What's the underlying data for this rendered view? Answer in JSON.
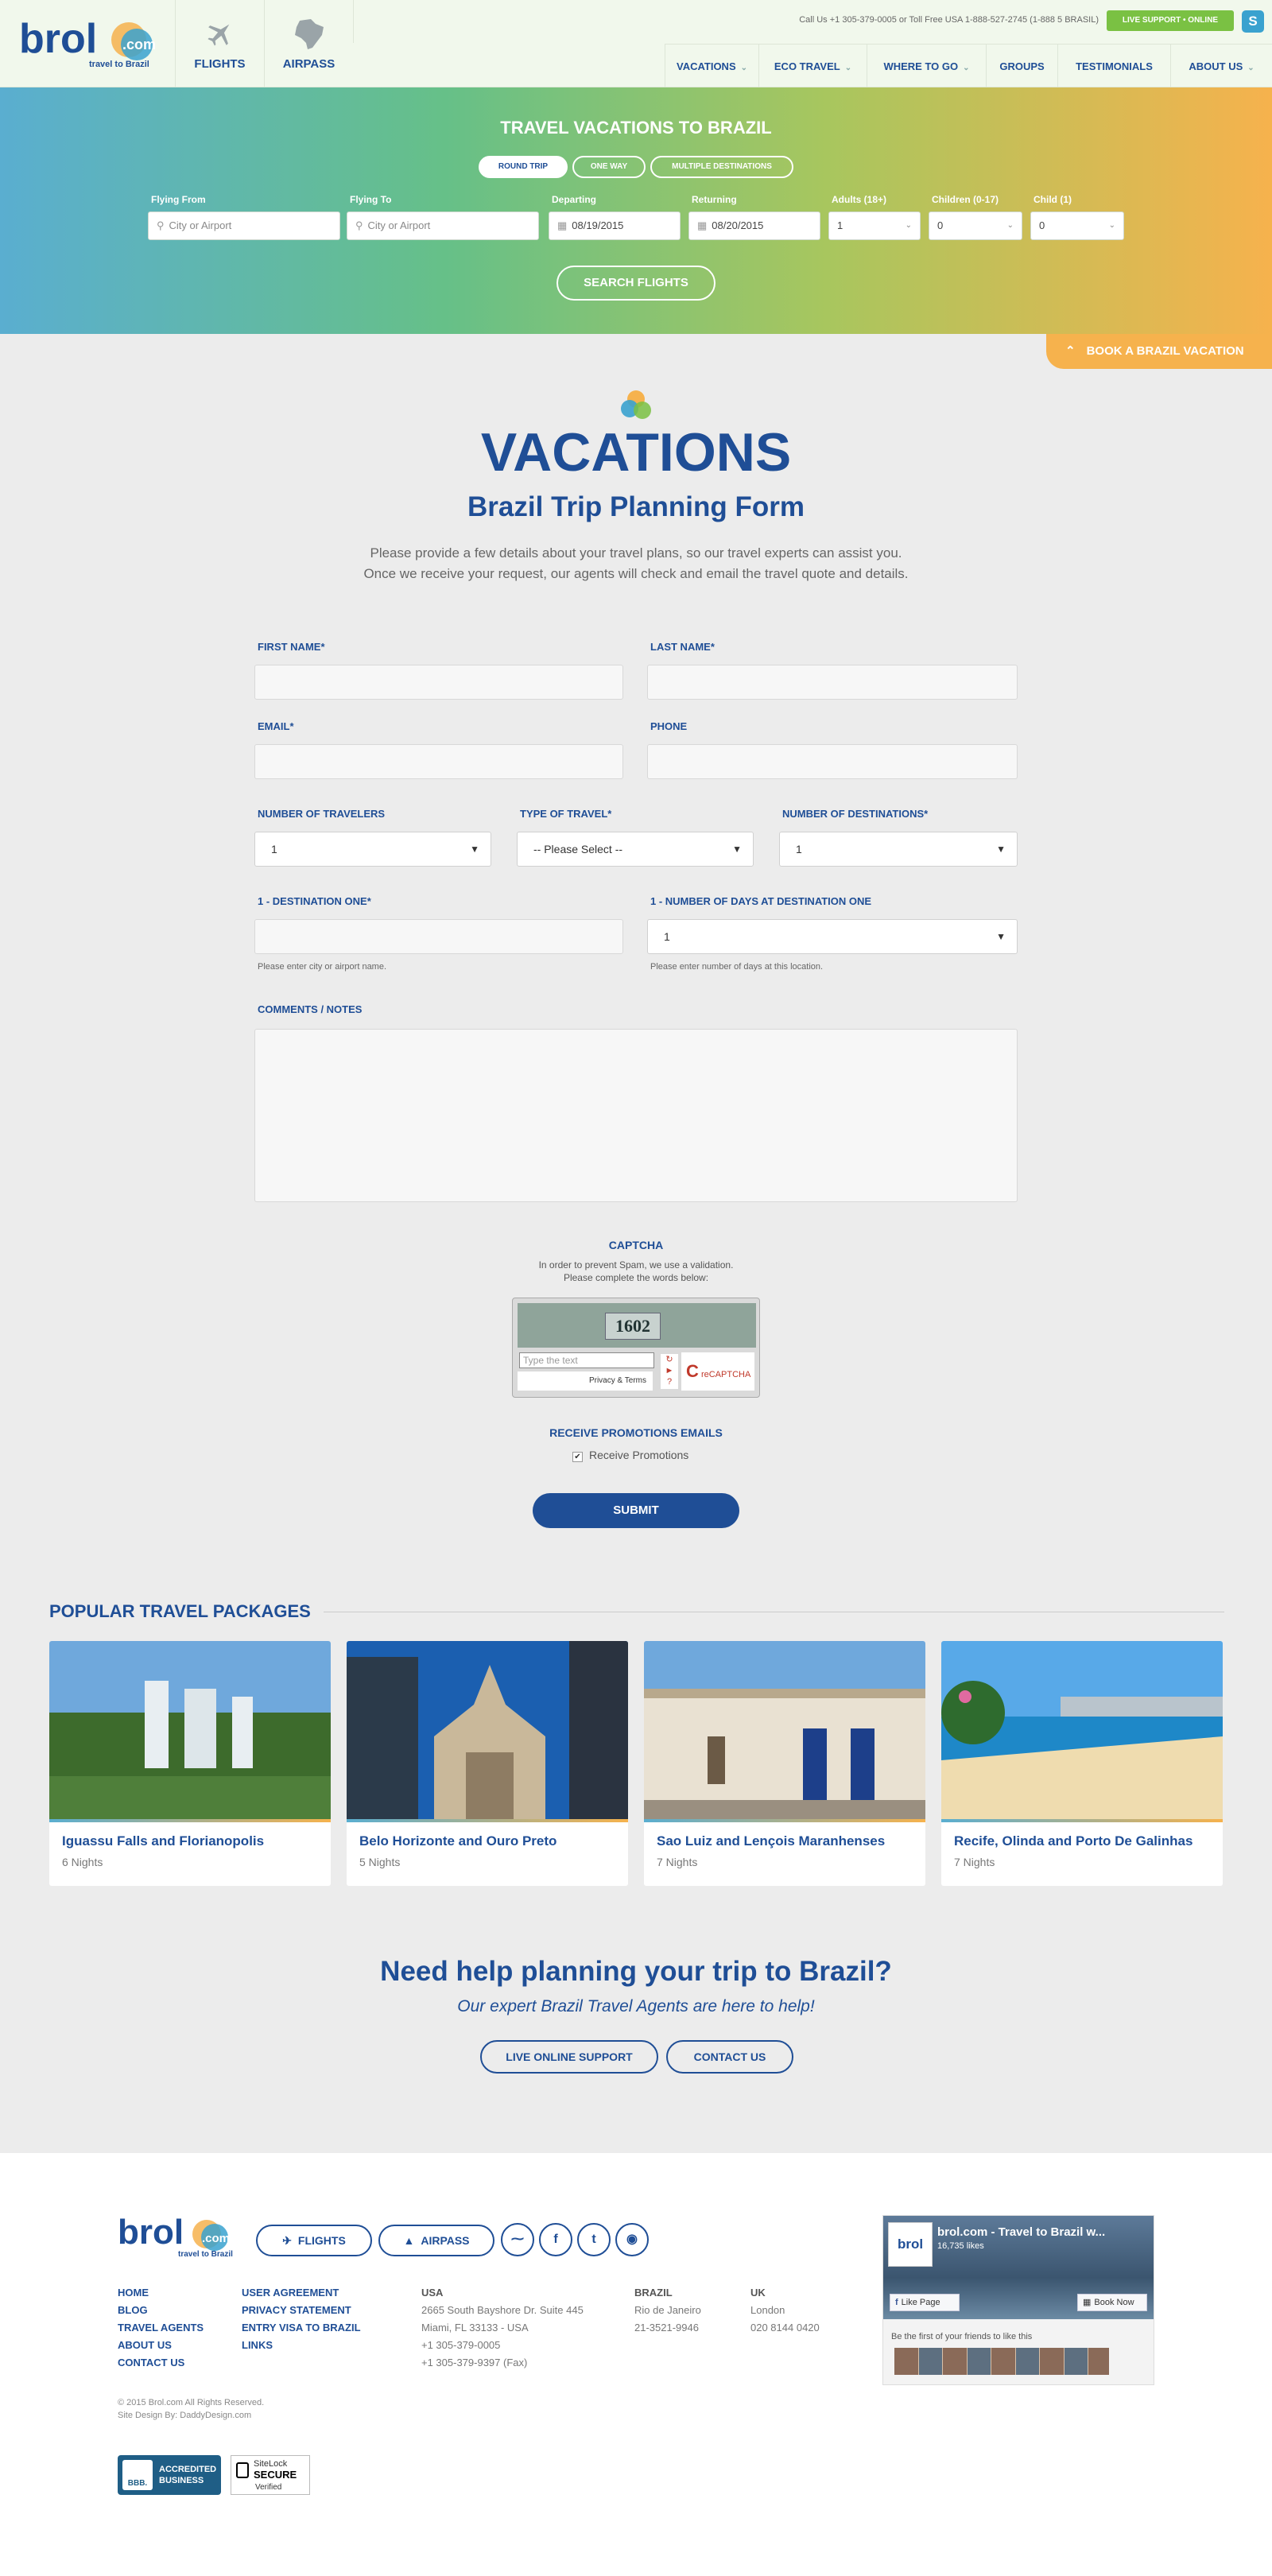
{
  "header": {
    "logo_text": "brol",
    "logo_com": ".com",
    "logo_tagline": "travel to Brazil",
    "tiles": [
      {
        "label": "FLIGHTS",
        "icon": "plane-icon"
      },
      {
        "label": "AIRPASS",
        "icon": "brazil-map-icon"
      }
    ],
    "call_us": "Call Us +1 305-379-0005 or Toll Free USA 1-888-527-2745 (1-888 5 BRASIL)",
    "live_support": "LIVE SUPPORT • ONLINE",
    "skype_icon": "skype-icon",
    "nav": [
      {
        "label": "VACATIONS",
        "dropdown": true
      },
      {
        "label": "ECO TRAVEL",
        "dropdown": true
      },
      {
        "label": "WHERE TO GO",
        "dropdown": true
      },
      {
        "label": "GROUPS",
        "dropdown": false
      },
      {
        "label": "TESTIMONIALS",
        "dropdown": false
      },
      {
        "label": "ABOUT US",
        "dropdown": true
      }
    ]
  },
  "flight_search": {
    "title": "TRAVEL VACATIONS TO BRAZIL",
    "trip_types": [
      "ROUND TRIP",
      "ONE WAY",
      "MULTIPLE DESTINATIONS"
    ],
    "active_trip_type": "ROUND TRIP",
    "flying_from_label": "Flying From",
    "flying_from_placeholder": "City or Airport",
    "flying_to_label": "Flying To",
    "flying_to_placeholder": "City or Airport",
    "departing_label": "Departing",
    "departing_value": "08/19/2015",
    "returning_label": "Returning",
    "returning_value": "08/20/2015",
    "adults_label": "Adults (18+)",
    "adults_value": "1",
    "children_label": "Children (0-17)",
    "children_value": "0",
    "child_label": "Child (1)",
    "child_value": "0",
    "search_button": "SEARCH FLIGHTS",
    "book_vacation": "BOOK A BRAZIL VACATION"
  },
  "main": {
    "section_title": "VACATIONS",
    "form_title": "Brazil Trip Planning Form",
    "intro_line1": "Please provide a few details about your travel plans, so our travel experts can assist you.",
    "intro_line2": "Once we receive your request, our agents will check and email the travel quote and details.",
    "form": {
      "first_name_label": "FIRST NAME*",
      "last_name_label": "LAST NAME*",
      "email_label": "EMAIL*",
      "phone_label": "PHONE",
      "travelers_label": "NUMBER OF TRAVELERS",
      "travelers_value": "1",
      "travel_type_label": "TYPE OF TRAVEL*",
      "travel_type_value": "-- Please Select --",
      "destinations_label": "NUMBER OF DESTINATIONS*",
      "destinations_value": "1",
      "dest_one_label": "1 - DESTINATION ONE*",
      "dest_one_hint": "Please enter city or airport name.",
      "days_label": "1 - NUMBER OF DAYS AT DESTINATION ONE",
      "days_value": "1",
      "days_hint": "Please enter number of days at this location.",
      "comments_label": "COMMENTS / NOTES",
      "captcha_title": "CAPTCHA",
      "captcha_line1": "In order to prevent Spam, we use a validation.",
      "captcha_line2": "Please complete the words below:",
      "captcha_code": "1602",
      "captcha_placeholder": "Type the text",
      "captcha_privacy": "Privacy & Terms",
      "captcha_brand": "reCAPTCHA",
      "promo_title": "RECEIVE PROMOTIONS EMAILS",
      "promo_checkbox": "Receive Promotions",
      "submit": "SUBMIT"
    }
  },
  "popular": {
    "title": "POPULAR TRAVEL PACKAGES",
    "packages": [
      {
        "name": "Iguassu Falls and Florianopolis",
        "nights": "6 Nights"
      },
      {
        "name": "Belo Horizonte and Ouro Preto",
        "nights": "5 Nights"
      },
      {
        "name": "Sao Luiz and Lençois Maranhenses",
        "nights": "7 Nights"
      },
      {
        "name": "Recife, Olinda and Porto De Galinhas",
        "nights": "7 Nights"
      }
    ]
  },
  "help": {
    "title": "Need help planning your trip to Brazil?",
    "subtitle": "Our expert Brazil Travel Agents are here to help!",
    "live_support": "LIVE ONLINE SUPPORT",
    "contact": "CONTACT US"
  },
  "footer": {
    "flights": "FLIGHTS",
    "airpass": "AIRPASS",
    "social_icons": [
      "rss-icon",
      "facebook-icon",
      "twitter-icon",
      "instagram-icon"
    ],
    "links_col1": [
      "HOME",
      "BLOG",
      "TRAVEL AGENTS",
      "ABOUT US",
      "CONTACT US"
    ],
    "links_col2": [
      "USER AGREEMENT",
      "PRIVACY STATEMENT",
      "ENTRY VISA TO BRAZIL",
      "LINKS"
    ],
    "usa": {
      "title": "USA",
      "lines": [
        "2665 South Bayshore Dr. Suite 445",
        "Miami, FL 33133 - USA",
        "+1 305-379-0005",
        "+1 305-379-9397 (Fax)"
      ]
    },
    "brazil": {
      "title": "BRAZIL",
      "lines": [
        "Rio de Janeiro",
        "21-3521-9946"
      ]
    },
    "uk": {
      "title": "UK",
      "lines": [
        "London",
        "020 8144 0420"
      ]
    },
    "copyright": "© 2015 Brol.com All Rights Reserved.",
    "design": "Site Design By: DaddyDesign.com",
    "bbb_line1": "ACCREDITED",
    "bbb_line2": "BUSINESS",
    "bbb_short": "BBB.",
    "sitelock_line1": "SiteLock",
    "sitelock_line2": "SECURE",
    "sitelock_line3": "Verified",
    "facebook": {
      "page_name": "brol.com - Travel to Brazil w...",
      "likes": "16,735 likes",
      "like_page": "Like Page",
      "book_now": "Book Now",
      "friends_text": "Be the first of your friends to like this"
    }
  },
  "colors": {
    "brand_blue": "#1f4e96",
    "accent_green": "#7ac143",
    "accent_orange": "#f6b24d"
  }
}
